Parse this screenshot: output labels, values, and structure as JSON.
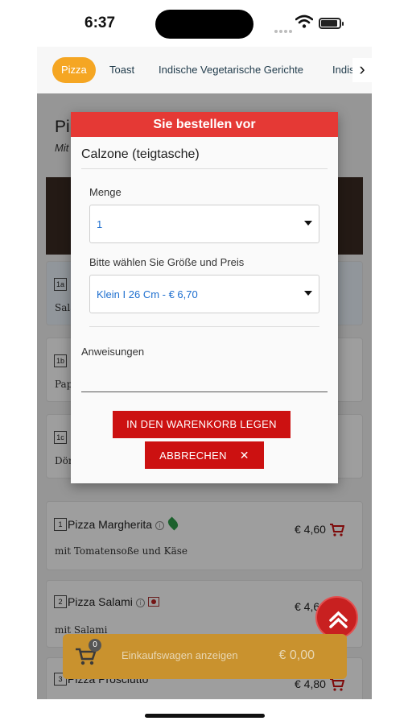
{
  "status_bar": {
    "time": "6:37"
  },
  "tabs": [
    {
      "label": "Pizza",
      "active": true
    },
    {
      "label": "Toast"
    },
    {
      "label": "Indische Vegetarische Gerichte"
    },
    {
      "label": "Indis"
    }
  ],
  "category": {
    "title": "Pi",
    "subtitle": "Mit"
  },
  "menu_items": [
    {
      "num": "1a",
      "desc": "Sala"
    },
    {
      "num": "1b",
      "desc": "Pap"
    },
    {
      "num": "1c",
      "desc": "Dör"
    },
    {
      "num": "1",
      "name": "Pizza Margherita",
      "desc": "mit Tomatensoße und Käse",
      "price": "€ 4,60"
    },
    {
      "num": "2",
      "name": "Pizza Salami",
      "desc": "mit Salami",
      "price": "€ 4,6"
    },
    {
      "num": "3",
      "name": "Pizza Prosciutto",
      "price": "€ 4,80"
    }
  ],
  "cart": {
    "count": "0",
    "label": "Einkaufswagen anzeigen",
    "total": "€ 0,00"
  },
  "modal": {
    "header": "Sie bestellen vor",
    "product": "Calzone (teigtasche)",
    "quantity_label": "Menge",
    "quantity_value": "1",
    "size_label": "Bitte wählen Sie Größe und Preis",
    "size_value": "Klein I 26 Cm - € 6,70",
    "instructions_label": "Anweisungen",
    "instructions_value": "",
    "add_button": "IN DEN WARENKORB LEGEN",
    "cancel_button": "ABBRECHEN"
  },
  "colors": {
    "accent": "#f5a623",
    "header_red": "#e53935",
    "button_red": "#cc1111",
    "link_blue": "#1e6fcf"
  }
}
